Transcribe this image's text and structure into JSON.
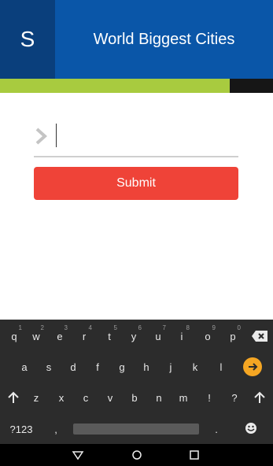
{
  "header": {
    "logo_letter": "S",
    "title": "World Biggest Cities"
  },
  "colors": {
    "header_blue": "#0a56a8",
    "logo_blue": "#0a3f7c",
    "accent_green": "#a8cb3f",
    "submit_red": "#ef4338",
    "enter_orange": "#f5a623"
  },
  "form": {
    "input_value": "",
    "input_prefix_icon": "chevron-right-icon",
    "submit_label": "Submit"
  },
  "keyboard": {
    "row1": [
      {
        "k": "q",
        "h": "1"
      },
      {
        "k": "w",
        "h": "2"
      },
      {
        "k": "e",
        "h": "3"
      },
      {
        "k": "r",
        "h": "4"
      },
      {
        "k": "t",
        "h": "5"
      },
      {
        "k": "y",
        "h": "6"
      },
      {
        "k": "u",
        "h": "7"
      },
      {
        "k": "i",
        "h": "8"
      },
      {
        "k": "o",
        "h": "9"
      },
      {
        "k": "p",
        "h": "0"
      }
    ],
    "row2": [
      "a",
      "s",
      "d",
      "f",
      "g",
      "h",
      "j",
      "k",
      "l"
    ],
    "row3": [
      "z",
      "x",
      "c",
      "v",
      "b",
      "n",
      "m",
      "!",
      "?"
    ],
    "row4": {
      "symbols": "?123",
      "comma": ",",
      "period": "."
    },
    "icons": {
      "backspace": "backspace-icon",
      "enter": "arrow-right-icon",
      "shift": "shift-icon",
      "emoji": "emoji-icon"
    }
  },
  "navbar": {
    "icons": [
      "back-icon",
      "home-icon",
      "recents-icon"
    ]
  }
}
